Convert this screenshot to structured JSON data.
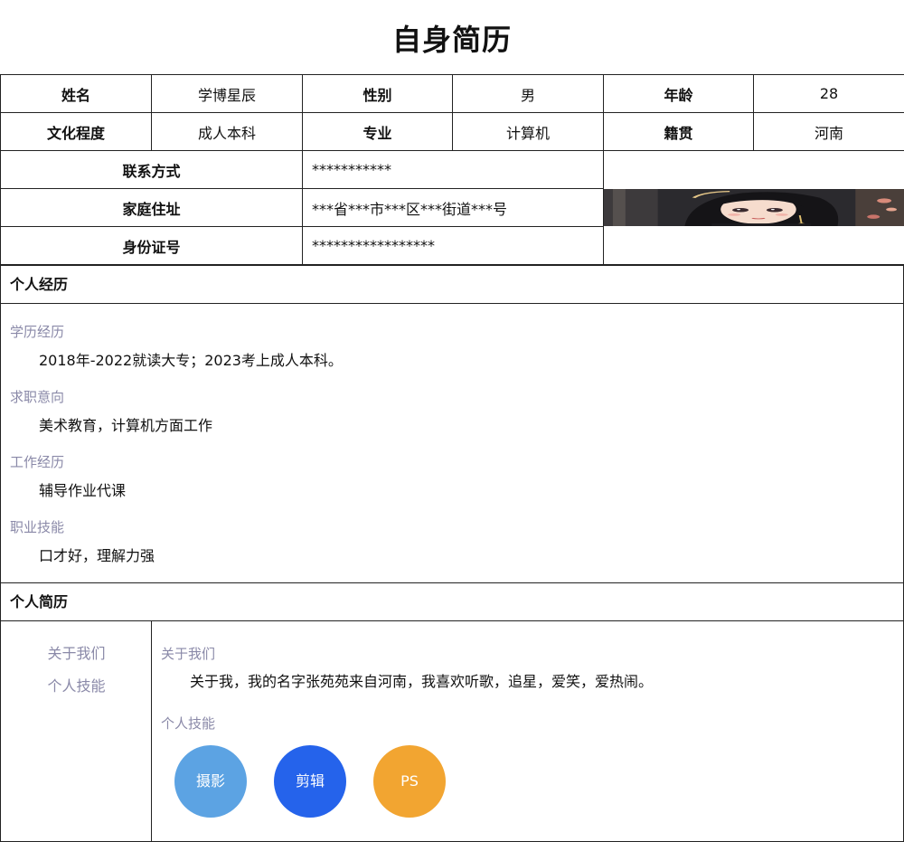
{
  "title": "自身简历",
  "basic_info": {
    "name_label": "姓名",
    "name_value": "学博星辰",
    "gender_label": "性别",
    "gender_value": "男",
    "age_label": "年龄",
    "age_value": "28",
    "education_label": "文化程度",
    "education_value": "成人本科",
    "major_label": "专业",
    "major_value": "计算机",
    "origin_label": "籍贯",
    "origin_value": "河南",
    "contact_label": "联系方式",
    "contact_value": "***********",
    "address_label": "家庭住址",
    "address_value": "***省***市***区***街道***号",
    "id_label": "身份证号",
    "id_value": "*****************"
  },
  "experience": {
    "header": "个人经历",
    "items": [
      {
        "label": "学历经历",
        "text": "2018年-2022就读大专；2023考上成人本科。"
      },
      {
        "label": "求职意向",
        "text": "美术教育，计算机方面工作"
      },
      {
        "label": "工作经历",
        "text": "辅导作业代课"
      },
      {
        "label": "职业技能",
        "text": "口才好，理解力强"
      }
    ]
  },
  "profile": {
    "header": "个人简历",
    "nav": [
      "关于我们",
      "个人技能"
    ],
    "about_label": "关于我们",
    "about_text": "关于我，我的名字张苑苑来自河南，我喜欢听歌，追星，爱笑，爱热闹。",
    "skills_label": "个人技能",
    "skills": [
      {
        "name": "摄影",
        "color": "#5ca3e3"
      },
      {
        "name": "剪辑",
        "color": "#2563eb"
      },
      {
        "name": "PS",
        "color": "#f2a531"
      }
    ]
  }
}
